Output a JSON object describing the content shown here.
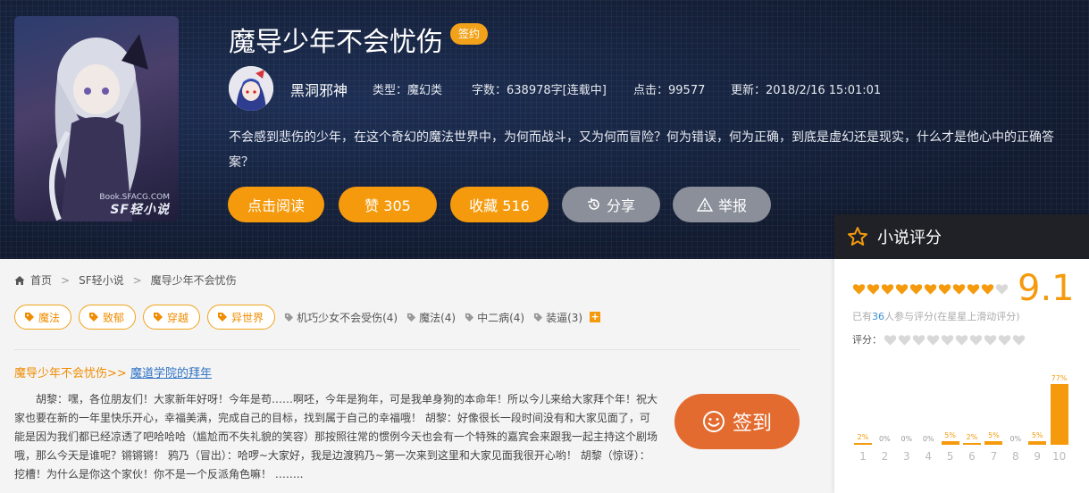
{
  "book": {
    "title": "魔导少年不会忧伤",
    "sign_badge": "签约",
    "cover_site": "Book.SFACG.COM",
    "cover_logo": "SF轻小说",
    "author": "黑洞邪神",
    "type": "类型：魔幻类",
    "words": "字数：638978字[连载中]",
    "clicks": "点击：99577",
    "updated": "更新：2018/2/16 15:01:01",
    "description": "不会感到悲伤的少年，在这个奇幻的魔法世界中，为何而战斗，又为何而冒险？何为错误，何为正确，到底是虚幻还是现实，什么才是他心中的正确答案？"
  },
  "actions": {
    "read": "点击阅读",
    "like": "赞 305",
    "favorite": "收藏 516",
    "share": "分享",
    "report": "举报"
  },
  "rating": {
    "title": "小说评分",
    "score": "9.1",
    "score_value": 9.1,
    "filled_hearts": 10,
    "total_hearts": 11,
    "count_prefix": "已有",
    "count": "36",
    "count_suffix": "人参与评分(在星星上滑动评分)",
    "my_rating_label": "评分：",
    "my_rating_hearts": 10,
    "distribution": [
      {
        "label": "1",
        "pct": "2%",
        "value": 2
      },
      {
        "label": "2",
        "pct": "0%",
        "value": 0
      },
      {
        "label": "3",
        "pct": "0%",
        "value": 0
      },
      {
        "label": "4",
        "pct": "0%",
        "value": 0
      },
      {
        "label": "5",
        "pct": "5%",
        "value": 5
      },
      {
        "label": "6",
        "pct": "2%",
        "value": 2
      },
      {
        "label": "7",
        "pct": "5%",
        "value": 5
      },
      {
        "label": "8",
        "pct": "0%",
        "value": 0
      },
      {
        "label": "9",
        "pct": "5%",
        "value": 5
      },
      {
        "label": "10",
        "pct": "77%",
        "value": 77
      }
    ]
  },
  "breadcrumb": [
    "首页",
    "SF轻小说",
    "魔导少年不会忧伤"
  ],
  "tags": {
    "official": [
      "魔法",
      "致郁",
      "穿越",
      "异世界"
    ],
    "user": [
      "机巧少女不会受伤(4)",
      "魔法(4)",
      "中二病(4)",
      "装逼(3)"
    ]
  },
  "chapter": {
    "book_link": "魔导少年不会忧伤>>",
    "chapter_link": "魔道学院的拜年"
  },
  "excerpt": "胡黎：嘿，各位朋友们！大家新年好呀！今年是苟……啊呸，今年是狗年，可是我单身狗的本命年！所以今儿来给大家拜个年！祝大家也要在新的一年里快乐开心，幸福美满，完成自己的目标，找到属于自己的幸福哦！ 胡黎：好像很长一段时间没有和大家见面了，可能是因为我们都已经凉透了吧哈哈哈（尴尬而不失礼貌的笑容）那按照往常的惯例今天也会有一个特殊的嘉宾会来跟我一起主持这个剧场哦，那么今天是谁呢？锵锵锵！ 鸦乃（冒出）：哈啰~大家好，我是边渡鸦乃~第一次来到这里和大家见面我很开心哟！ 胡黎（惊讶）：挖槽！为什么是你这个家伙！你不是一个反派角色嘛！ ……..",
  "signin": "签到",
  "colors": {
    "accent": "#f59a0c",
    "signin": "#e36b2f",
    "link": "#2f73c4"
  }
}
